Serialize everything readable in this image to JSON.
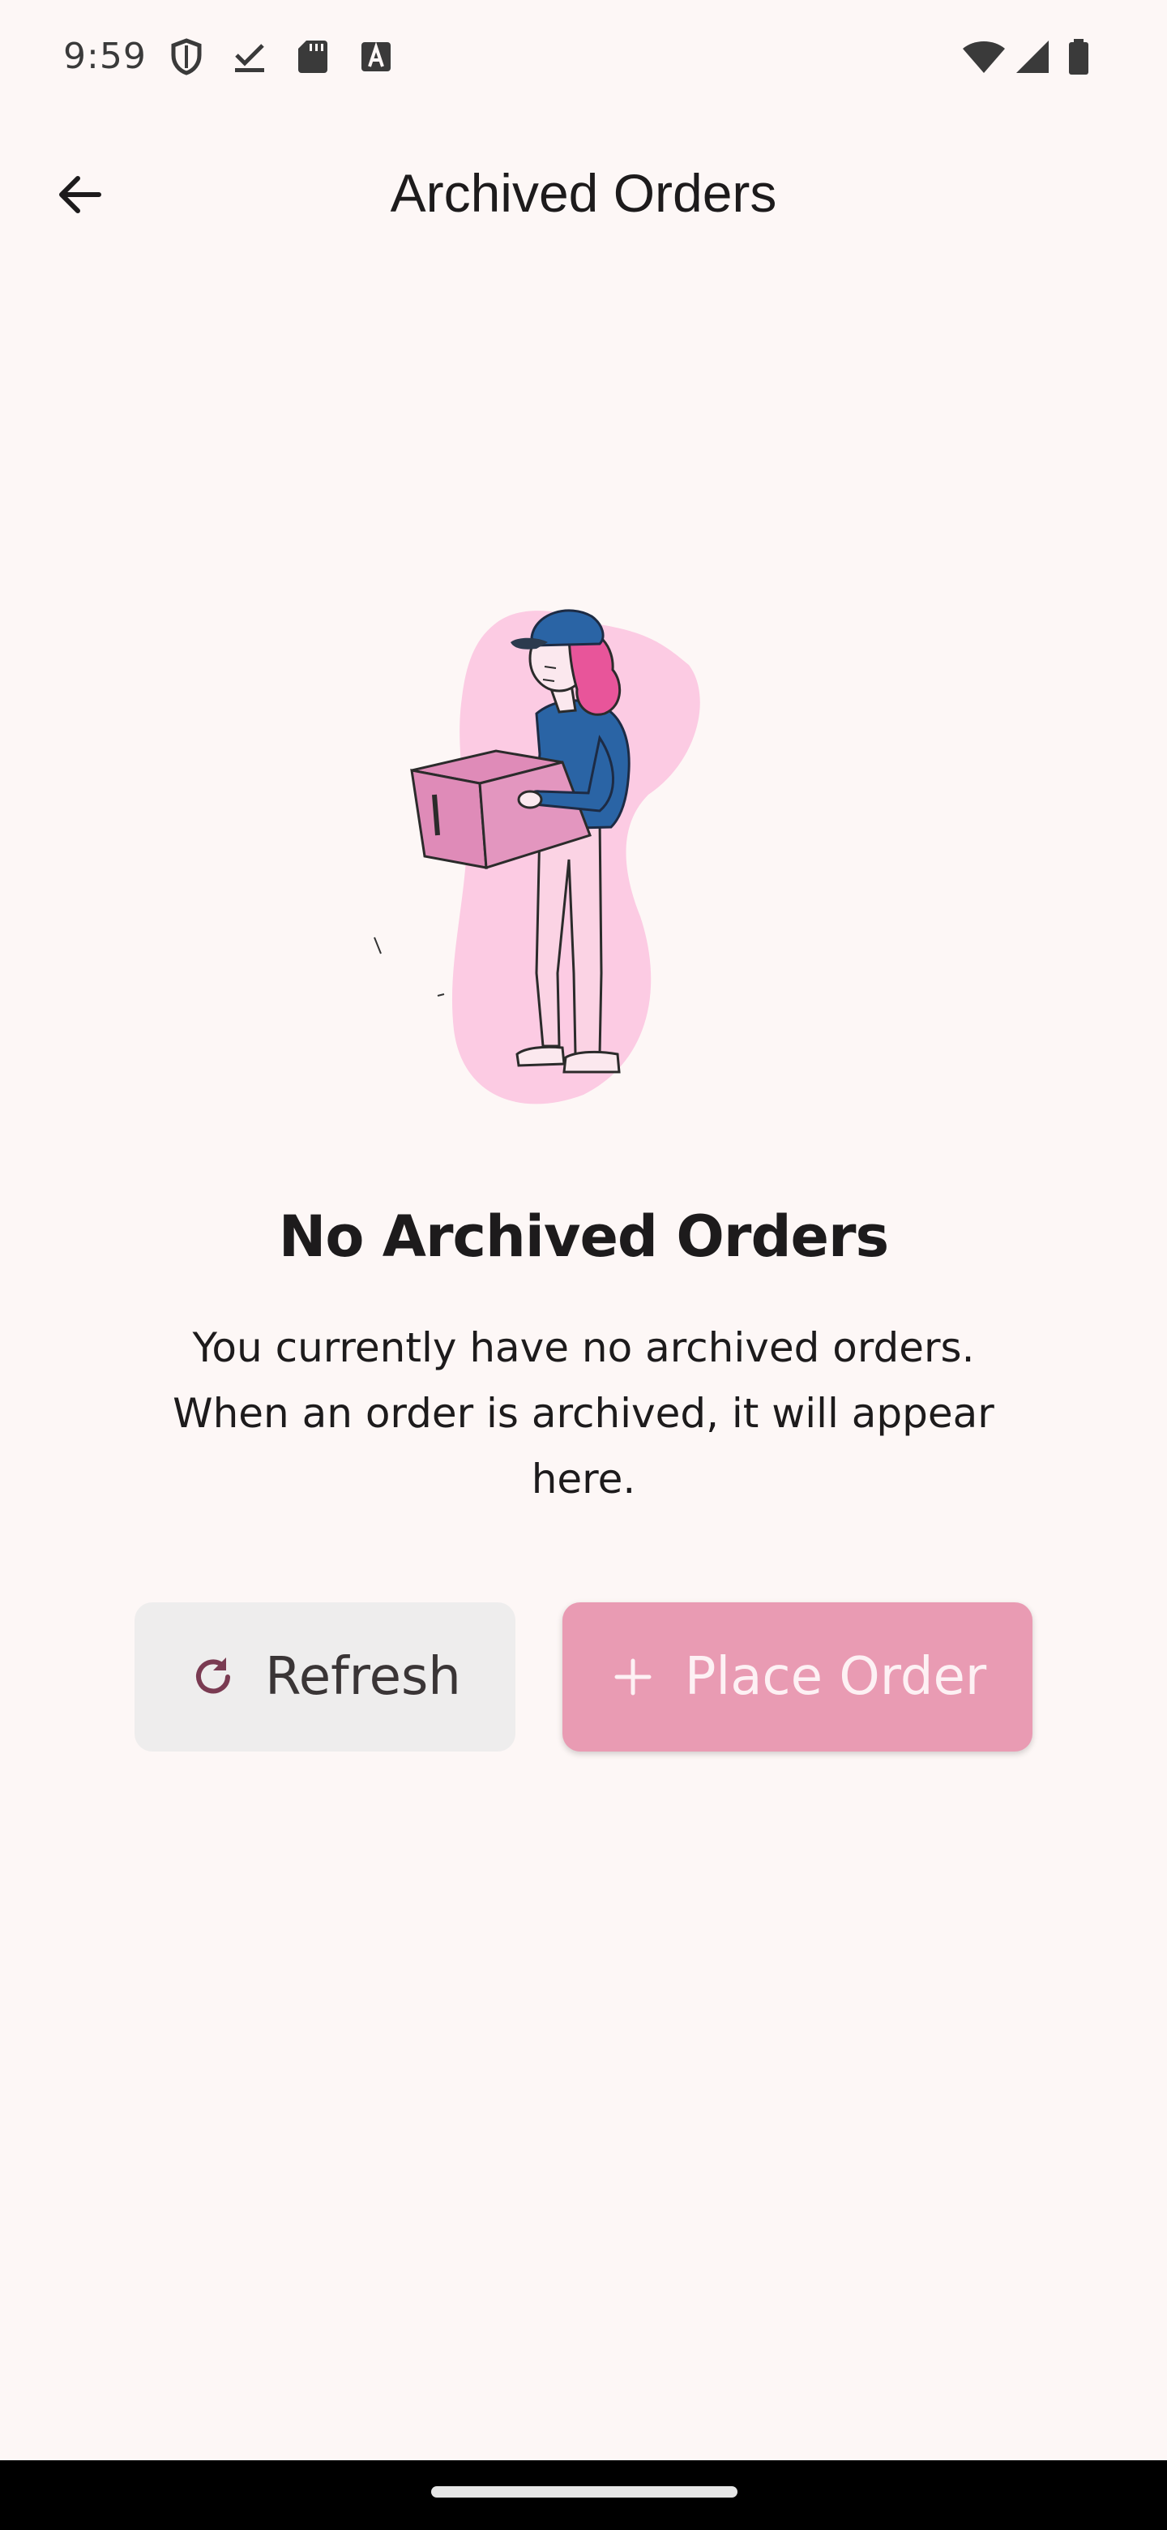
{
  "status_bar": {
    "time": "9:59",
    "icons_left": [
      "shield-icon",
      "download-done-icon",
      "sd-card-icon",
      "font-a-icon"
    ],
    "icons_right": [
      "wifi-icon",
      "cell-signal-icon",
      "battery-icon"
    ]
  },
  "app_bar": {
    "title": "Archived Orders",
    "back_icon": "arrow-back-icon"
  },
  "empty_state": {
    "illustration": "woman-holding-box-illustration",
    "title": "No Archived Orders",
    "description": "You currently have no archived orders. When an order is archived, it will appear here."
  },
  "actions": {
    "refresh_label": "Refresh",
    "refresh_icon": "refresh-icon",
    "place_order_label": "Place Order",
    "place_order_icon": "plus-icon"
  },
  "colors": {
    "background": "#fdf7f6",
    "refresh_button_bg": "#eeeded",
    "place_order_button_bg": "#e99bb3",
    "accent_dark": "#7a3b52",
    "illustration_blob": "#fccbe3",
    "illustration_blue": "#2a64a5",
    "illustration_hair": "#e8559a"
  }
}
